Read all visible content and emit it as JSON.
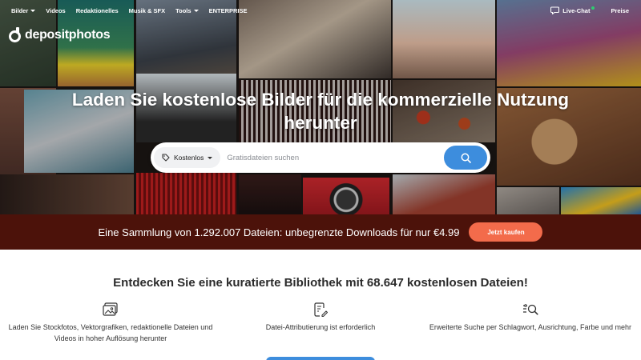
{
  "nav": {
    "items": [
      {
        "label": "Bilder",
        "dropdown": true
      },
      {
        "label": "Videos",
        "dropdown": false
      },
      {
        "label": "Redaktionelles",
        "dropdown": false
      },
      {
        "label": "Musik & SFX",
        "dropdown": false
      },
      {
        "label": "Tools",
        "dropdown": true
      },
      {
        "label": "ENTERPRISE",
        "dropdown": false
      }
    ],
    "live_chat": "Live-Chat",
    "pricing": "Preise"
  },
  "logo": {
    "text": "depositphotos",
    "icon": "depositphotos-logo-icon"
  },
  "hero": {
    "headline": "Laden Sie kostenlose Bilder für die kommerzielle Nutzung herunter"
  },
  "search": {
    "filter_label": "Kostenlos",
    "filter_icon": "tag-icon",
    "placeholder": "Gratisdateien suchen",
    "button_icon": "search-icon"
  },
  "promo": {
    "text": "Eine Sammlung von 1.292.007 Dateien: unbegrenzte Downloads für nur €4.99",
    "button": "Jetzt kaufen"
  },
  "discover": {
    "title": "Entdecken Sie eine kuratierte Bibliothek mit 68.647 kostenlosen Dateien!",
    "features": [
      {
        "icon": "image-gallery-icon",
        "text": "Laden Sie Stockfotos, Vektorgrafiken, redaktionelle Dateien und Videos in hoher Auflösung herunter"
      },
      {
        "icon": "document-edit-icon",
        "text": "Datei-Attributierung ist erforderlich"
      },
      {
        "icon": "advanced-search-icon",
        "text": "Erweiterte Suche per Schlagwort, Ausrichtung, Farbe und mehr"
      }
    ]
  },
  "colors": {
    "promo_bg": "#4c120a",
    "buy_button": "#f36b4b",
    "search_button": "#3d8ddd",
    "online_dot": "#2ecc71"
  }
}
